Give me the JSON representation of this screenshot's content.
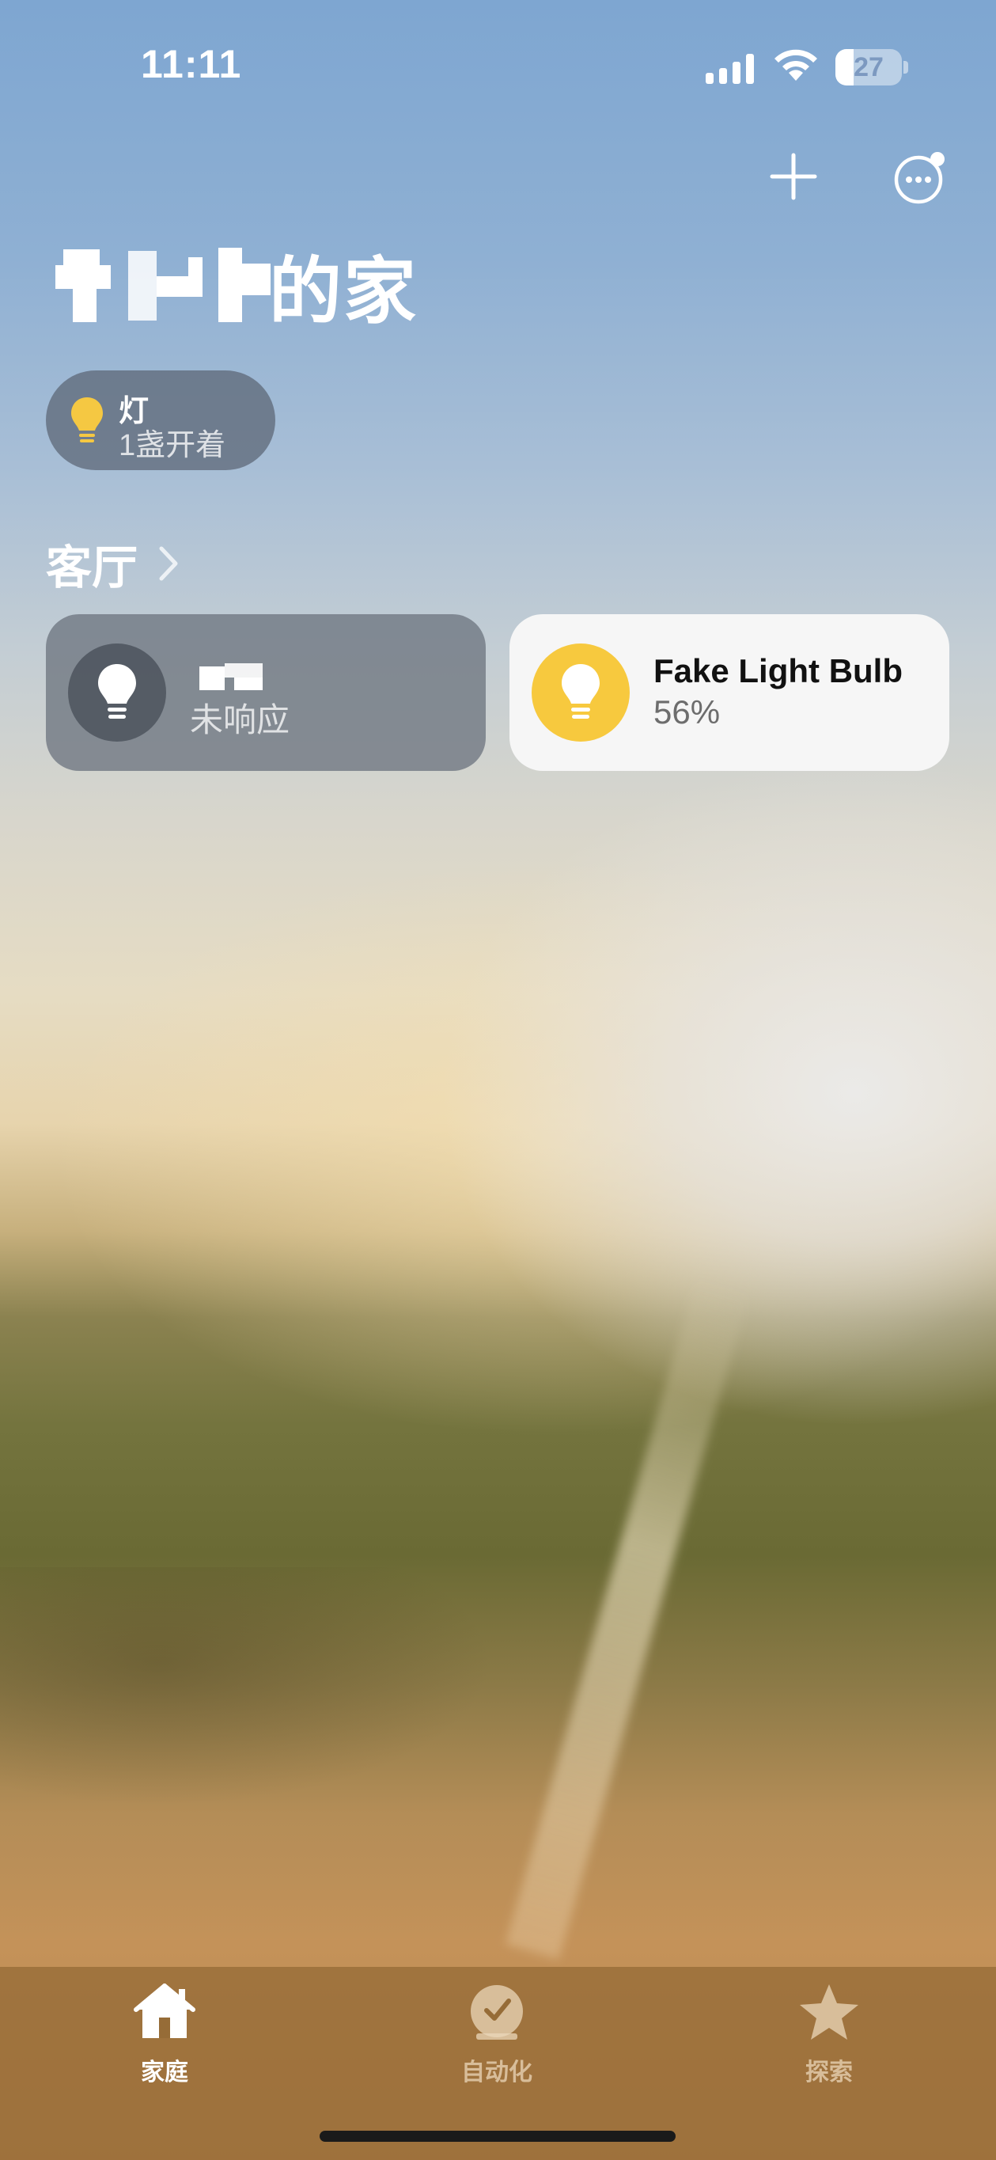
{
  "status_bar": {
    "time": "11:11",
    "battery_level": "27",
    "battery_fraction": 0.27
  },
  "header": {
    "add_icon": "plus-icon",
    "more_icon": "ellipsis-circle-icon",
    "title_visible": "的家"
  },
  "lights_chip": {
    "icon": "lightbulb-icon",
    "title": "灯",
    "subtitle": "1盏开着",
    "icon_color": "#f5c842"
  },
  "room": {
    "name": "客厅",
    "chevron": "chevron-right-icon"
  },
  "accessories": [
    {
      "name": "",
      "status": "未响应",
      "icon": "lightbulb-icon",
      "state": "unresponsive"
    },
    {
      "name": "Fake Light Bulb",
      "status": "56%",
      "icon": "lightbulb-icon",
      "state": "on",
      "accent": "#f7c93e"
    }
  ],
  "tab_bar": {
    "tabs": [
      {
        "label": "家庭",
        "icon": "house-icon",
        "selected": true
      },
      {
        "label": "自动化",
        "icon": "clock-check-icon",
        "selected": false
      },
      {
        "label": "探索",
        "icon": "star-icon",
        "selected": false
      }
    ]
  }
}
